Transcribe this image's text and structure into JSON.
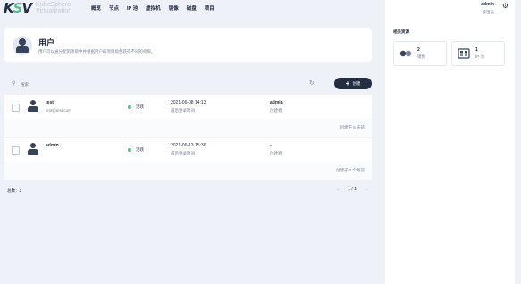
{
  "brand": {
    "mark": "KSV",
    "line1": "KubeSphere",
    "line2": "Virtualization"
  },
  "nav": {
    "items": [
      "概览",
      "节点",
      "IP 池",
      "虚拟机",
      "镜像",
      "磁盘",
      "项目"
    ]
  },
  "user_menu": {
    "name": "admin",
    "role": "管理员"
  },
  "page": {
    "title": "用户",
    "description": "用户可以被分配到项目中并根据用户的项目角色获得不同的权限。"
  },
  "toolbar": {
    "search_placeholder": "搜索",
    "create_label": "创建"
  },
  "users": [
    {
      "name": "test",
      "email": "test@test.com",
      "status": "活跃",
      "last_login": "2021-06-08 14:13",
      "last_login_label": "最后登录时间",
      "creator": "admin",
      "creator_label": "创建者",
      "created_ago": "创建于 5 天前"
    },
    {
      "name": "admin",
      "email": "",
      "status": "活跃",
      "last_login": "2021-06-13 15:36",
      "last_login_label": "最后登录时间",
      "creator": "-",
      "creator_label": "创建者",
      "created_ago": "创建于 2 个月前"
    }
  ],
  "pagination": {
    "total_label": "总数：2",
    "prev": "←",
    "page": "1 / 1",
    "next": "→"
  },
  "related": {
    "title": "相关资源",
    "items": [
      {
        "count": "2",
        "label": "镜像",
        "icon": "images-icon"
      },
      {
        "count": "1",
        "label": "IP 池",
        "icon": "ip-pool-icon"
      }
    ]
  },
  "colors": {
    "accent": "#55bc8a",
    "dark": "#242e42",
    "background": "#eef2f8"
  }
}
